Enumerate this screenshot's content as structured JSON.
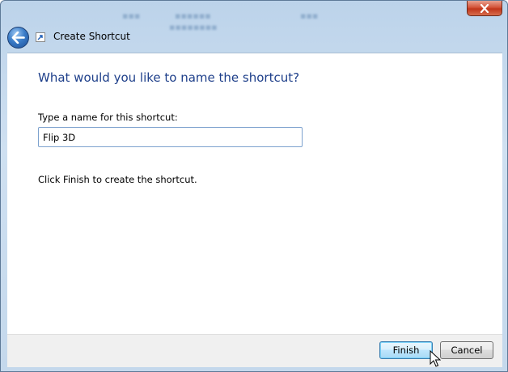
{
  "window": {
    "title": "Create Shortcut",
    "close_icon": "close-icon",
    "back_icon": "back-arrow-icon",
    "wizard_icon": "shortcut-icon"
  },
  "page": {
    "heading": "What would you like to name the shortcut?",
    "name_label": "Type a name for this shortcut:",
    "name_value": "Flip 3D",
    "hint": "Click Finish to create the shortcut."
  },
  "buttons": {
    "finish": "Finish",
    "cancel": "Cancel"
  },
  "colors": {
    "heading": "#1e3f8a",
    "close": "#c1361b",
    "back": "#3a7cc8"
  }
}
